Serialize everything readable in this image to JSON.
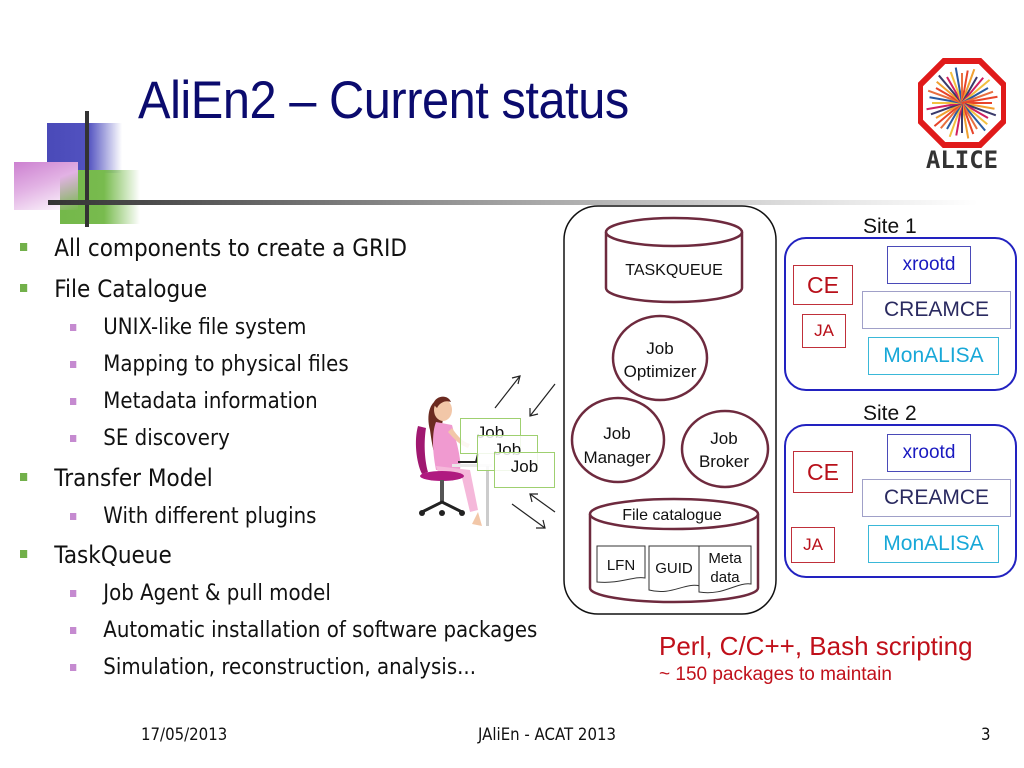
{
  "slide": {
    "title": "AliEn2 – Current status",
    "logo": {
      "name": "alice-logo",
      "text": "ALICE",
      "ring_color": "#e01a1a"
    },
    "bullets": [
      {
        "level": 1,
        "text": "All components to create a GRID"
      },
      {
        "level": 1,
        "text": "File Catalogue"
      },
      {
        "level": 2,
        "text": "UNIX-like file system"
      },
      {
        "level": 2,
        "text": "Mapping to physical files"
      },
      {
        "level": 2,
        "text": "Metadata information"
      },
      {
        "level": 2,
        "text": "SE discovery"
      },
      {
        "level": 1,
        "text": "Transfer Model"
      },
      {
        "level": 2,
        "text": "With different plugins"
      },
      {
        "level": 1,
        "text": "TaskQueue"
      },
      {
        "level": 2,
        "text": "Job Agent & pull model"
      },
      {
        "level": 2,
        "text": "Automatic installation of software packages"
      },
      {
        "level": 2,
        "text": "Simulation, reconstruction, analysis..."
      }
    ],
    "bullet_colors": {
      "level1": "#72b04a",
      "level2": "#c58ad0"
    },
    "title_color": "#0b0b6e",
    "note": {
      "line1": "Perl, C/C++, Bash scripting",
      "line2": "~ 150 packages to maintain",
      "color": "#c0101a"
    },
    "footer": {
      "date": "17/05/2013",
      "center": "JAliEn - ACAT 2013",
      "page": "3"
    }
  },
  "diagram": {
    "central": {
      "taskqueue": "TASKQUEUE",
      "job_optimizer": [
        "Job",
        "Optimizer"
      ],
      "job_manager": [
        "Job",
        "Manager"
      ],
      "job_broker": [
        "Job",
        "Broker"
      ],
      "file_catalogue": "File catalogue",
      "docs": [
        "LFN",
        "GUID",
        "Meta",
        "data"
      ]
    },
    "jobs": [
      "Job",
      "Job",
      "Job"
    ],
    "sites": [
      {
        "label": "Site 1",
        "ce": "CE",
        "ja": "JA",
        "xrootd": "xrootd",
        "creamce": "CREAMCE",
        "monalisa": "MonALISA"
      },
      {
        "label": "Site 2",
        "ce": "CE",
        "ja": "JA",
        "xrootd": "xrootd",
        "creamce": "CREAMCE",
        "monalisa": "MonALISA"
      }
    ],
    "colors": {
      "component_stroke": "#6e2a3e",
      "site_border": "#2222c0",
      "ce": "#b8101a",
      "xrootd": "#1a1ac0",
      "monalisa": "#18a8d8",
      "job_box": "#9fd070"
    }
  }
}
